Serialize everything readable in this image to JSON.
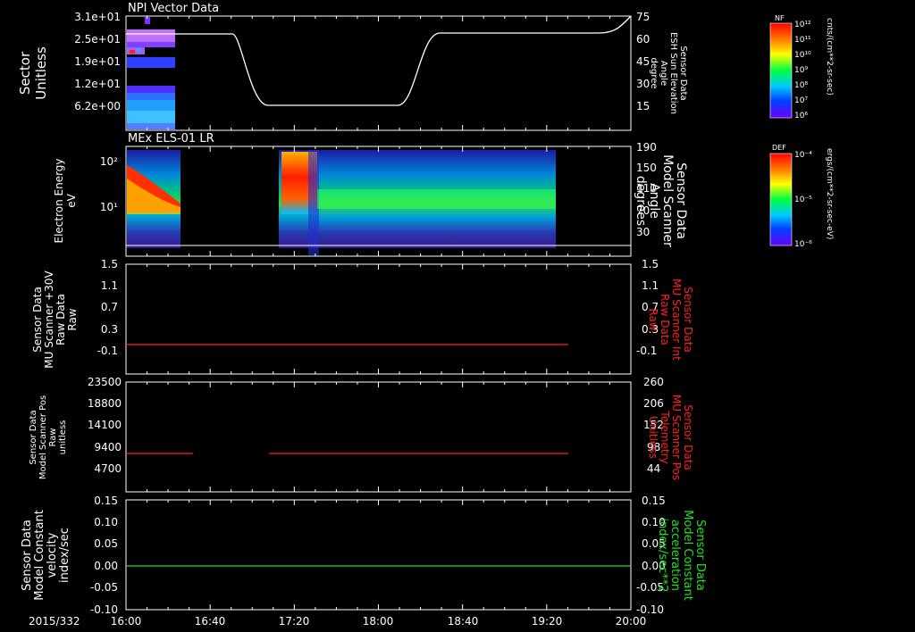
{
  "date_label": "2015/332",
  "time_ticks": [
    "16:00",
    "16:40",
    "17:20",
    "18:00",
    "18:40",
    "19:20",
    "20:00"
  ],
  "colors": {
    "red_line": "#ff2020",
    "green_line": "#22e022",
    "white_line": "#ffffff",
    "axis": "#ffffff"
  },
  "colorbars": [
    {
      "tag": "NF",
      "unit": "cnts/(cm**2-sr-sec)",
      "ticks": [
        "10¹²",
        "10¹¹",
        "10¹⁰",
        "10⁹",
        "10⁸",
        "10⁷",
        "10⁶"
      ]
    },
    {
      "tag": "DEF",
      "unit": "ergs/(cm**2-sr-sec-eV)",
      "ticks": [
        "10⁻⁴",
        "10⁻⁵",
        "10⁻⁶"
      ]
    }
  ],
  "chart_data": [
    {
      "type": "heatmap",
      "title": "NPI Vector Data",
      "ylabel": [
        "Sector",
        "Unitless"
      ],
      "ytick_labels": [
        "3.1e+01",
        "2.5e+01",
        "1.9e+01",
        "1.2e+01",
        "6.2e+00"
      ],
      "ylim": [
        0,
        31
      ],
      "heatmap_time_range": [
        "16:00",
        "16:40"
      ],
      "y2label": [
        "Sensor Data",
        "ESH Sun Elevation",
        "Angle",
        "degree"
      ],
      "y2tick_labels": [
        "75",
        "60",
        "45",
        "30",
        "15"
      ],
      "y2lim": [
        0,
        75
      ],
      "series": [
        {
          "x": [
            "16:00",
            "16:40",
            "16:55",
            "17:05",
            "17:15",
            "18:00",
            "18:15",
            "18:25",
            "18:40",
            "19:40",
            "20:00"
          ],
          "values": [
            63,
            63,
            62,
            40,
            12,
            12,
            12,
            40,
            63,
            63,
            72
          ]
        }
      ]
    },
    {
      "type": "heatmap",
      "title": "MEx ELS-01 LR",
      "ylabel": [
        "Electron Energy",
        "eV"
      ],
      "ytick_labels": [
        "10²",
        "10¹"
      ],
      "yscale": "log",
      "heatmap_time_ranges": [
        [
          "16:00",
          "16:40"
        ],
        [
          "17:15",
          "19:25"
        ]
      ],
      "y2label": [
        "Sensor Data",
        "Model Scanner",
        "Angle",
        "degrees"
      ],
      "y2tick_labels": [
        "190",
        "150",
        "110",
        "70",
        "30"
      ],
      "y2lim": [
        0,
        190
      ],
      "series": [
        {
          "x": [
            "16:00",
            "20:00"
          ],
          "values": [
            5,
            5
          ]
        }
      ]
    },
    {
      "type": "line",
      "ylabel": [
        "Sensor Data",
        "MU Scanner +30V",
        "Raw Data",
        "Raw"
      ],
      "ytick_labels": [
        "1.5",
        "1.1",
        "0.7",
        "0.3",
        "-0.1"
      ],
      "ylim": [
        -0.3,
        1.5
      ],
      "y2label": [
        "Sensor Data",
        "MU Scanner Int",
        "Raw Data",
        "Raw"
      ],
      "y2tick_labels": [
        "1.5",
        "1.1",
        "0.7",
        "0.3",
        "-0.1"
      ],
      "series": [
        {
          "x": [
            "16:00",
            "19:30"
          ],
          "values": [
            0.0,
            0.0
          ]
        }
      ]
    },
    {
      "type": "line",
      "ylabel": [
        "Sensor Data",
        "Model Scanner Pos",
        "Raw",
        "unitless"
      ],
      "ytick_labels": [
        "23500",
        "18800",
        "14100",
        "9400",
        "4700"
      ],
      "ylim": [
        0,
        23500
      ],
      "y2label": [
        "Sensor Data",
        "MU Scanner Pos",
        "Telemetry",
        "Unitless"
      ],
      "y2tick_labels": [
        "260",
        "206",
        "152",
        "98",
        "44"
      ],
      "series": [
        {
          "x": [
            "16:00",
            "16:47"
          ],
          "values": [
            8300,
            8300
          ]
        },
        {
          "x": [
            "17:10",
            "19:30"
          ],
          "values": [
            8300,
            8300
          ]
        }
      ]
    },
    {
      "type": "line",
      "ylabel": [
        "Sensor Data",
        "Model Constant",
        "velocity",
        "index/sec"
      ],
      "ytick_labels": [
        "0.15",
        "0.10",
        "0.05",
        "0.00",
        "-0.05",
        "-0.10"
      ],
      "ylim": [
        -0.1,
        0.15
      ],
      "y2label": [
        "Sensor Data",
        "Model Constant",
        "acceleration",
        "index/sec**2"
      ],
      "y2tick_labels": [
        "0.15",
        "0.10",
        "0.05",
        "0.00",
        "-0.05",
        "-0.10"
      ],
      "series": [
        {
          "x": [
            "16:00",
            "20:00"
          ],
          "values": [
            0.0,
            0.0
          ]
        }
      ]
    }
  ]
}
